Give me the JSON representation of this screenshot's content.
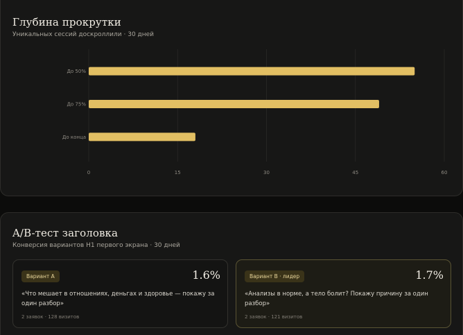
{
  "scroll_card": {
    "title": "Глубина прокрутки",
    "subtitle": "Уникальных сессий доскроллили · 30 дней"
  },
  "chart_data": {
    "type": "bar",
    "orientation": "horizontal",
    "categories": [
      "До 50%",
      "До 75%",
      "До конца"
    ],
    "values": [
      55,
      49,
      18
    ],
    "xlim": [
      0,
      60
    ],
    "xticks": [
      "0",
      "15",
      "30",
      "45",
      "60"
    ],
    "bar_color": "#e2bf63",
    "grid": true,
    "legend": "none"
  },
  "ab_card": {
    "title": "A/B-тест заголовка",
    "subtitle": "Конверсия вариантов H1 первого экрана · 30 дней",
    "variants": [
      {
        "badge": "Вариант A",
        "rate": "1.6%",
        "quote": "«Что мешает в отношениях, деньгах и здоровье — покажу за один разбор»",
        "stats": "2 заявок · 128 визитов"
      },
      {
        "badge": "Вариант B · лидер",
        "rate": "1.7%",
        "quote": "«Анализы в норме, а тело болит? Покажу причину за один разбор»",
        "stats": "2 заявок · 121 визитов"
      }
    ]
  }
}
